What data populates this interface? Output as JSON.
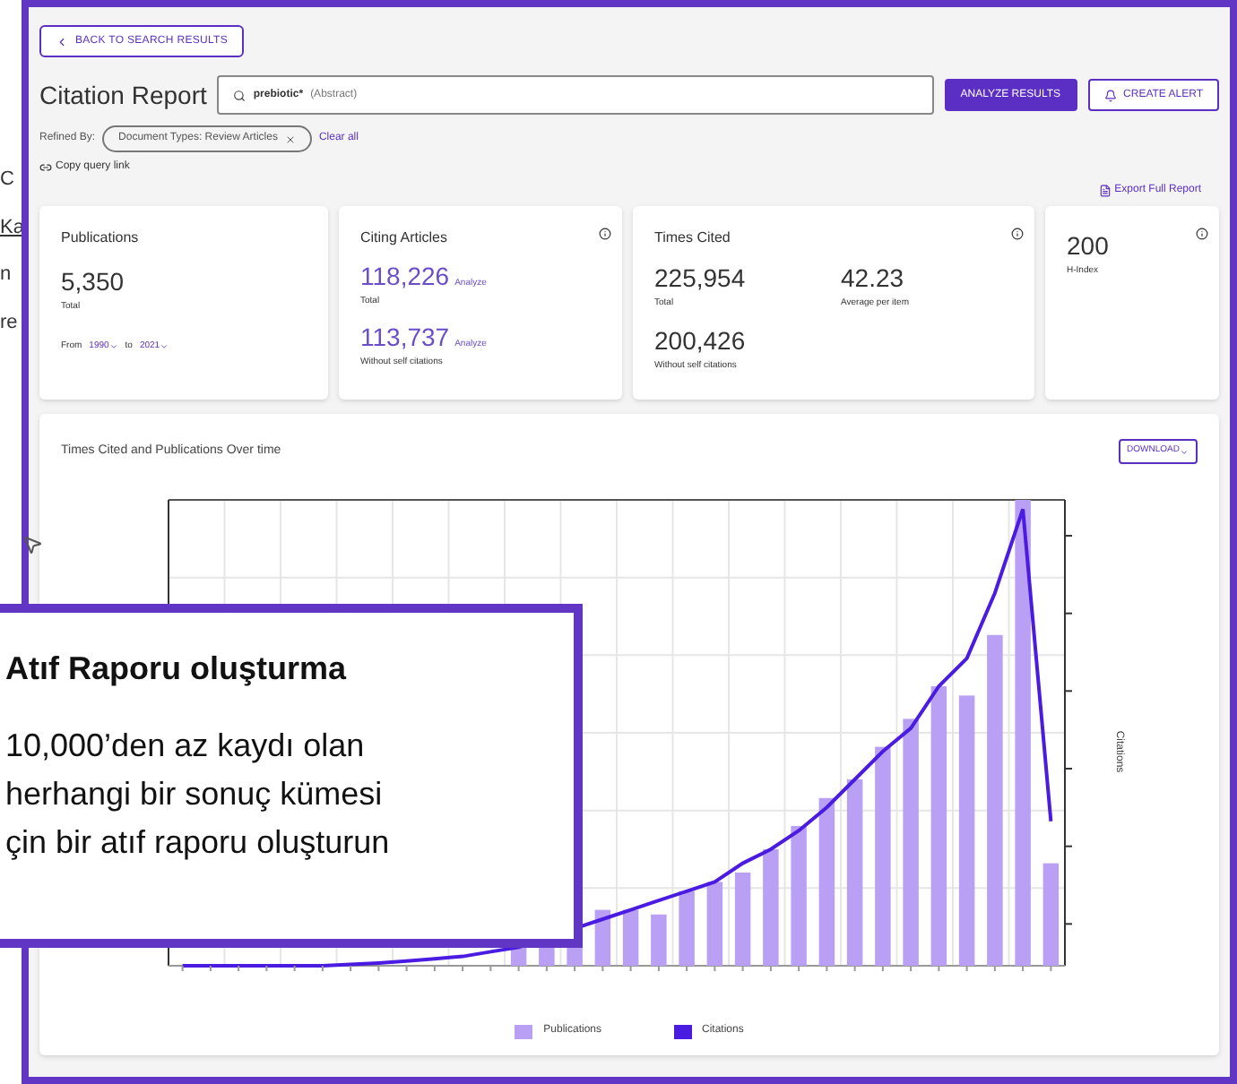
{
  "background_fragments": [
    "C",
    "Ka",
    "n",
    "re"
  ],
  "back_button": "BACK TO SEARCH RESULTS",
  "title": "Citation Report",
  "search": {
    "query": "prebiotic*",
    "field": "(Abstract)"
  },
  "buttons": [
    {
      "label": "ANALYZE RESULTS",
      "kind": "primary"
    },
    {
      "label": "CREATE ALERT",
      "kind": "alert"
    }
  ],
  "refined_by": {
    "label": "Refined By:",
    "chip": "Document Types: Review Articles",
    "clear": "Clear all"
  },
  "copy_link": "Copy query link",
  "export": "Export Full Report",
  "publications": {
    "title": "Publications",
    "value": "5,350",
    "caption": "Total",
    "from_label": "From",
    "from": "1990",
    "to_label": "to",
    "to": "2021"
  },
  "citing_articles": {
    "title": "Citing Articles",
    "rows": [
      {
        "value": "118,226",
        "link": "Analyze",
        "caption": "Total"
      },
      {
        "value": "113,737",
        "link": "Analyze",
        "caption": "Without self citations"
      }
    ]
  },
  "times_cited": {
    "title": "Times Cited",
    "stats": [
      {
        "value": "225,954",
        "caption": "Total"
      },
      {
        "value": "42.23",
        "caption": "Average per item"
      },
      {
        "value": "200,426",
        "caption": "Without self citations"
      }
    ]
  },
  "h_index": {
    "value": "200",
    "caption": "H-Index"
  },
  "chart": {
    "title": "Times Cited and Publications Over time",
    "download": "DOWNLOAD",
    "right_axis": "Citations",
    "legend": [
      {
        "name": "Publications",
        "color": "#b9a0f4"
      },
      {
        "name": "Citations",
        "color": "#4a1be0"
      }
    ]
  },
  "callout": {
    "title": "Atıf Raporu oluşturma",
    "lines": [
      "10,000’den az kaydı olan",
      "herhangi bir sonuç kümesi",
      "çin bir atıf raporu oluşturun"
    ]
  }
}
